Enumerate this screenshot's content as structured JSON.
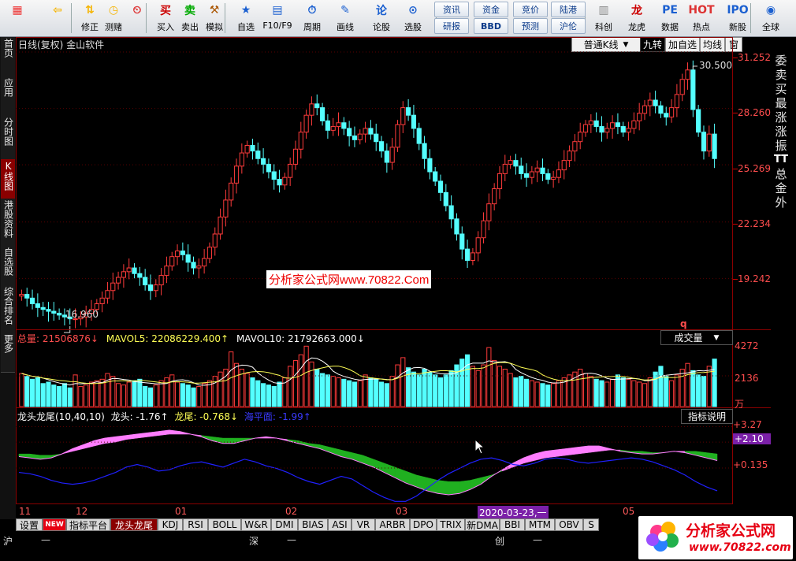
{
  "toolbar": {
    "items": [
      {
        "label": "",
        "icon": "grid-icon"
      },
      {
        "label": "",
        "icon": "back-arrow-icon"
      },
      {
        "label": "修正",
        "icon": "up-down-icon"
      },
      {
        "label": "测赌",
        "icon": "coin-icon"
      },
      {
        "label": "",
        "icon": "clock-icon"
      },
      {
        "label": "买入",
        "icon": "buy-icon"
      },
      {
        "label": "卖出",
        "icon": "sell-icon"
      },
      {
        "label": "模拟",
        "icon": "hammer-icon"
      },
      {
        "label": "自选",
        "icon": "star-icon"
      },
      {
        "label": "F10/F9",
        "icon": "doc-icon"
      },
      {
        "label": "周期",
        "icon": "clock-icon"
      },
      {
        "label": "画线",
        "icon": "pencil-icon"
      },
      {
        "label": "论股",
        "icon": "forum-icon"
      },
      {
        "label": "选股",
        "icon": "search-icon"
      },
      {
        "label": "科创",
        "icon": "chart-icon"
      },
      {
        "label": "龙虎",
        "icon": "dragon-icon"
      },
      {
        "label": "数据",
        "icon": "pe-icon"
      },
      {
        "label": "热点",
        "icon": "hot-icon"
      },
      {
        "label": "新股",
        "icon": "ipo-icon"
      },
      {
        "label": "全球",
        "icon": "globe-icon"
      }
    ],
    "pills": [
      "资讯",
      "资金",
      "竞价",
      "陆港",
      "研报",
      "BBD",
      "预测",
      "沪伦"
    ]
  },
  "header": {
    "title": "日线(复权)  金山软件",
    "kline_mode": "普通K线",
    "buttons": [
      "九转",
      "加自选",
      "均线",
      "窗"
    ]
  },
  "left_nav": [
    "首页",
    "应用",
    "分时图",
    "K线图",
    "港股资料",
    "自选股",
    "综合排名",
    "更多"
  ],
  "right_nav": [
    "委",
    "卖",
    "买",
    "最",
    "涨",
    "涨",
    "振",
    "TT",
    "总",
    "金",
    "外"
  ],
  "price_axis": [
    "31.252",
    "28.260",
    "25.269",
    "22.234",
    "19.242"
  ],
  "volume_axis": [
    "4272",
    "2136",
    "万"
  ],
  "indicator_axis": [
    "+3.27",
    "+2.10",
    "+0.135"
  ],
  "annotations": {
    "high": "30.500",
    "low": "16.960",
    "marker": "q"
  },
  "volume_legend": {
    "total": "总量: 21506876↓",
    "mavol5": "MAVOL5: 22086229.400↑",
    "mavol10": "MAVOL10: 21792663.000↓",
    "selector": "成交量"
  },
  "indicator_legend": {
    "name": "龙头龙尾(10,40,10)",
    "head": "龙头: -1.76↑",
    "tail": "龙尾: -0.768↓",
    "sea": "海平面: -1.99↑",
    "help": "指标说明"
  },
  "watermark": "分析家公式网www.70822.Com",
  "dates": [
    "11",
    "12",
    "01",
    "02",
    "03",
    "2020-03-23,一",
    "05"
  ],
  "tabs": [
    "设置",
    "NEW",
    "指标平台",
    "龙头龙尾",
    "KDJ",
    "RSI",
    "BOLL",
    "W&R",
    "DMI",
    "BIAS",
    "ASI",
    "VR",
    "ARBR",
    "DPO",
    "TRIX",
    "新DMA",
    "BBI",
    "MTM",
    "OBV",
    "S"
  ],
  "ticker": {
    "sh": "沪",
    "sz": "深",
    "cy": "创",
    "dash": "—"
  },
  "logo": {
    "title": "分析家公式网",
    "url": "www.70822.com"
  },
  "colors": {
    "up": "#ff3b3b",
    "down": "#54ffff",
    "accent": "#8a0000",
    "ma": "#ffffff",
    "pink": "#ff7dff",
    "green": "#20b020",
    "blue": "#2020ff"
  },
  "chart_data": [
    {
      "type": "candlestick",
      "title": "日线(复权)  金山软件",
      "ylim": [
        16.96,
        31.252
      ],
      "yticks": [
        31.252,
        28.26,
        25.269,
        22.234,
        19.242
      ],
      "x_ticks": [
        "11",
        "12",
        "01",
        "02",
        "03",
        "2020-03-23,一",
        "05"
      ],
      "high": 30.5,
      "low": 16.96,
      "close": [
        18.4,
        18.2,
        17.9,
        17.7,
        17.6,
        17.5,
        17.4,
        17.3,
        17.2,
        17.1,
        17.1,
        17.2,
        17.4,
        17.6,
        17.9,
        18.2,
        18.6,
        19.0,
        19.3,
        19.6,
        19.8,
        19.5,
        19.3,
        18.9,
        18.6,
        18.9,
        19.4,
        19.9,
        20.4,
        20.7,
        20.5,
        20.1,
        19.8,
        19.9,
        20.3,
        20.9,
        21.6,
        22.5,
        23.4,
        24.3,
        25.2,
        25.9,
        26.3,
        26.0,
        25.6,
        25.3,
        24.9,
        24.5,
        24.2,
        24.6,
        25.3,
        26.1,
        27.0,
        27.9,
        28.5,
        28.3,
        27.6,
        27.1,
        27.3,
        27.5,
        27.2,
        26.8,
        26.6,
        26.9,
        27.2,
        26.9,
        26.5,
        26.0,
        25.4,
        26.2,
        27.4,
        28.3,
        27.9,
        27.2,
        26.4,
        25.6,
        24.9,
        24.4,
        23.8,
        23.1,
        22.4,
        21.6,
        20.8,
        20.2,
        20.6,
        21.4,
        22.3,
        23.2,
        24.0,
        24.8,
        25.3,
        25.5,
        25.2,
        24.8,
        24.6,
        24.9,
        25.1,
        24.8,
        24.5,
        24.6,
        25.0,
        25.5,
        26.0,
        26.5,
        27.0,
        27.4,
        27.6,
        27.3,
        27.0,
        27.2,
        27.5,
        27.3,
        27.0,
        27.2,
        27.6,
        28.0,
        28.4,
        28.7,
        28.4,
        28.0,
        27.8,
        28.3,
        29.0,
        29.8,
        30.3,
        28.2,
        27.0,
        26.0,
        26.9,
        25.6
      ]
    },
    {
      "type": "bar",
      "title": "成交量",
      "ylim": [
        0,
        4272
      ],
      "yticks": [
        4272,
        2136
      ],
      "y_unit": "万",
      "values": [
        2300,
        2100,
        1900,
        2000,
        1600,
        1700,
        1500,
        1400,
        1600,
        1300,
        2200,
        1400,
        1500,
        1700,
        1800,
        1900,
        2300,
        2100,
        1600,
        1500,
        1700,
        1800,
        1900,
        1400,
        1300,
        1500,
        1800,
        2000,
        2200,
        1700,
        1600,
        1500,
        1300,
        1400,
        1600,
        1800,
        2100,
        2400,
        2600,
        3800,
        3000,
        2600,
        2300,
        2000,
        1800,
        1600,
        1500,
        1400,
        1700,
        2000,
        2800,
        3200,
        3600,
        4200,
        3100,
        2600,
        2300,
        2200,
        2100,
        2000,
        1900,
        1800,
        1700,
        1800,
        2200,
        2000,
        1900,
        1700,
        1600,
        2100,
        2900,
        3400,
        2700,
        2400,
        2200,
        2600,
        2400,
        2200,
        2000,
        2200,
        2500,
        2900,
        3300,
        3600,
        2800,
        2500,
        2900,
        4100,
        3200,
        2800,
        2600,
        2300,
        2000,
        2100,
        1900,
        1800,
        1700,
        1600,
        1500,
        1600,
        1800,
        2000,
        2200,
        2400,
        2600,
        2300,
        2100,
        1900,
        1800,
        1700,
        1900,
        2200,
        2000,
        1900,
        1800,
        1700,
        1600,
        2000,
        2400,
        2800,
        2100,
        1800,
        2200,
        2600,
        3000,
        2500,
        2200,
        2100,
        2800,
        3300
      ],
      "series_lines": [
        "MAVOL5",
        "MAVOL10"
      ]
    },
    {
      "type": "line",
      "title": "龙头龙尾(10,40,10)",
      "ylim": [
        -2.5,
        3.6
      ],
      "yticks": [
        3.27,
        2.1,
        0.135
      ],
      "series": [
        {
          "name": "龙头",
          "values": [
            1.0,
            0.9,
            0.8,
            0.9,
            1.2,
            1.6,
            1.9,
            2.2,
            2.4,
            2.5,
            2.6,
            2.7,
            2.8,
            2.9,
            3.0,
            2.9,
            2.7,
            2.5,
            2.2,
            2.0,
            2.0,
            2.2,
            2.4,
            2.5,
            2.4,
            2.2,
            2.0,
            1.8,
            1.6,
            1.3,
            1.0,
            0.8,
            0.5,
            0.2,
            -0.2,
            -0.6,
            -1.0,
            -1.3,
            -1.6,
            -1.8,
            -1.9,
            -1.8,
            -1.5,
            -1.1,
            -0.5,
            0.0,
            0.5,
            0.9,
            1.2,
            1.4,
            1.5,
            1.6,
            1.7,
            1.8,
            1.8,
            1.6,
            1.4,
            1.3,
            1.2,
            1.2,
            1.3,
            1.4,
            1.3,
            1.1,
            0.9,
            0.7
          ]
        },
        {
          "name": "龙尾",
          "values": [
            1.2,
            1.2,
            1.1,
            1.1,
            1.2,
            1.4,
            1.6,
            1.8,
            2.0,
            2.1,
            2.3,
            2.4,
            2.5,
            2.6,
            2.7,
            2.7,
            2.7,
            2.6,
            2.5,
            2.4,
            2.4,
            2.4,
            2.4,
            2.4,
            2.4,
            2.3,
            2.2,
            2.0,
            1.9,
            1.7,
            1.5,
            1.3,
            1.1,
            0.8,
            0.5,
            0.2,
            -0.1,
            -0.4,
            -0.6,
            -0.8,
            -0.9,
            -0.9,
            -0.8,
            -0.6,
            -0.4,
            -0.1,
            0.2,
            0.5,
            0.7,
            0.9,
            1.0,
            1.1,
            1.2,
            1.3,
            1.4,
            1.5,
            1.5,
            1.4,
            1.4,
            1.3,
            1.3,
            1.4,
            1.4,
            1.4,
            1.3,
            1.2
          ]
        },
        {
          "name": "海平面",
          "values": [
            -0.2,
            -0.3,
            -0.5,
            -0.8,
            -1.0,
            -1.1,
            -1.0,
            -0.8,
            -0.5,
            -0.2,
            0.2,
            0.4,
            0.2,
            -0.1,
            0.0,
            0.3,
            0.5,
            0.6,
            0.4,
            0.2,
            0.5,
            0.8,
            0.6,
            0.3,
            0.1,
            -0.2,
            -0.6,
            -0.9,
            -1.1,
            -0.8,
            -0.5,
            -0.7,
            -1.2,
            -1.7,
            -2.1,
            -2.4,
            -2.4,
            -2.0,
            -1.4,
            -0.8,
            -0.3,
            0.1,
            0.5,
            0.8,
            0.9,
            0.7,
            0.4,
            0.3,
            0.5,
            0.8,
            0.9,
            0.8,
            0.6,
            0.5,
            0.6,
            0.7,
            0.8,
            0.9,
            0.8,
            0.6,
            0.3,
            0.0,
            -0.4,
            -0.9,
            -1.3,
            -1.6
          ]
        }
      ]
    }
  ]
}
